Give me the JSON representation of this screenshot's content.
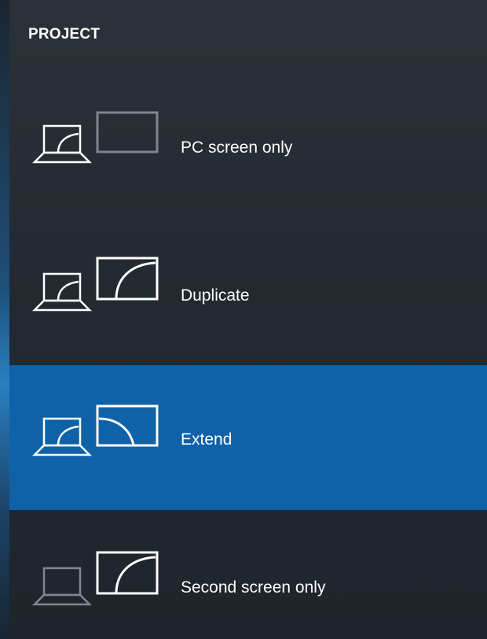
{
  "panel": {
    "title": "PROJECT",
    "accent": "#0f62a8",
    "options": [
      {
        "label": "PC screen only",
        "icon": "pc-screen-only-icon",
        "selected": false
      },
      {
        "label": "Duplicate",
        "icon": "duplicate-icon",
        "selected": false
      },
      {
        "label": "Extend",
        "icon": "extend-icon",
        "selected": true
      },
      {
        "label": "Second screen only",
        "icon": "second-screen-only-icon",
        "selected": false
      }
    ]
  }
}
